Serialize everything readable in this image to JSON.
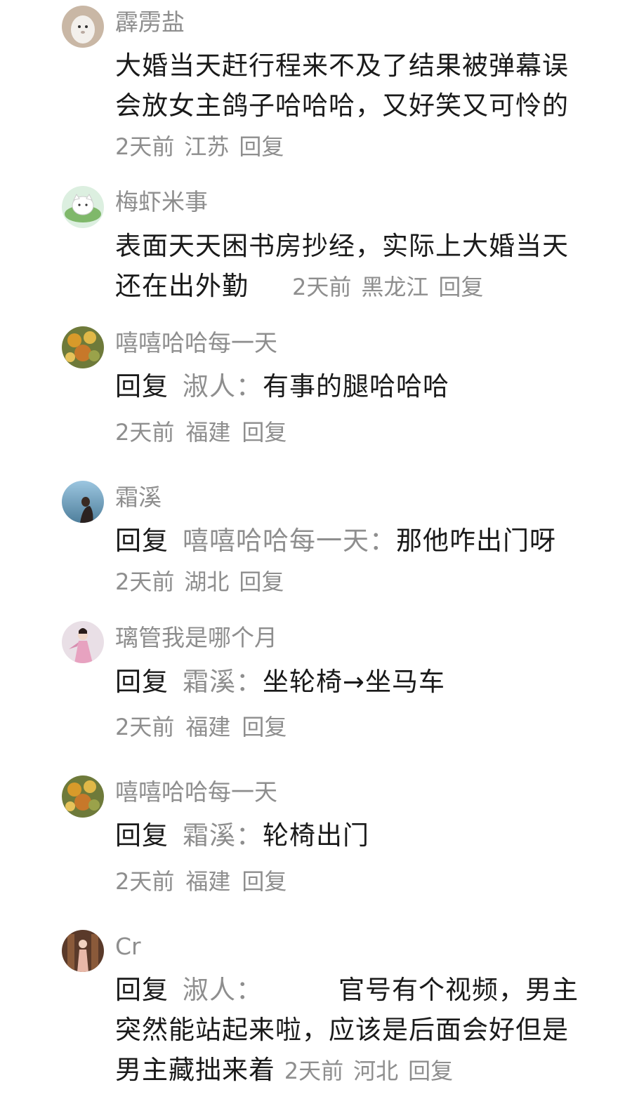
{
  "comments": [
    {
      "avatar_icon": "ghost-avatar-icon",
      "username": "霹雳盐",
      "text": "大婚当天赶行程来不及了结果被弹幕误会放女主鸽子哈哈哈，又好笑又可怜的",
      "time": "2天前",
      "location": "江苏",
      "reply_label": "回复"
    },
    {
      "avatar_icon": "cat-on-leaf-avatar-icon",
      "username": "梅虾米事",
      "text": "表面天天困书房抄经，实际上大婚当天还在出外勤",
      "time": "2天前",
      "location": "黑龙江",
      "reply_label": "回复"
    },
    {
      "avatar_icon": "autumn-leaves-avatar-icon",
      "username": "嘻嘻哈哈每一天",
      "reply_word": "回复",
      "reply_to": "淑人：",
      "text": "有事的腿哈哈哈",
      "time": "2天前",
      "location": "福建",
      "reply_label": "回复"
    },
    {
      "avatar_icon": "girl-by-sea-avatar-icon",
      "username": "霜溪",
      "reply_word": "回复",
      "reply_to": "嘻嘻哈哈每一天：",
      "text": "那他咋出门呀",
      "time": "2天前",
      "location": "湖北",
      "reply_label": "回复"
    },
    {
      "avatar_icon": "hanfu-girl-avatar-icon",
      "username": "璃管我是哪个月",
      "reply_word": "回复",
      "reply_to": "霜溪：",
      "text": "坐轮椅→坐马车",
      "time": "2天前",
      "location": "福建",
      "reply_label": "回复"
    },
    {
      "avatar_icon": "autumn-leaves-avatar-icon",
      "username": "嘻嘻哈哈每一天",
      "reply_word": "回复",
      "reply_to": "霜溪：",
      "text": "轮椅出门",
      "time": "2天前",
      "location": "福建",
      "reply_label": "回复"
    },
    {
      "avatar_icon": "costume-figure-avatar-icon",
      "username": "Cr",
      "reply_word": "回复",
      "reply_to": "淑人：",
      "text": "官号有个视频，男主突然能站起来啦，应该是后面会好但是男主藏拙来着",
      "time": "2天前",
      "location": "河北",
      "reply_label": "回复"
    }
  ]
}
